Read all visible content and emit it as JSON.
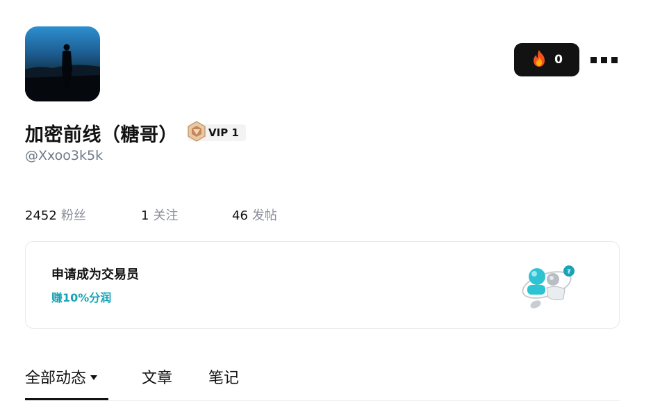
{
  "profile": {
    "name": "加密前线（糖哥）",
    "handle": "@Xxoo3k5k",
    "vip_label": "VIP 1"
  },
  "actions": {
    "fire_count": "0"
  },
  "stats": {
    "followers": {
      "value": "2452",
      "label": "粉丝"
    },
    "following": {
      "value": "1",
      "label": "关注"
    },
    "posts": {
      "value": "46",
      "label": "发帖"
    }
  },
  "trader_card": {
    "title": "申请成为交易员",
    "subtitle": "赚10%分润",
    "accent_color": "#1aa3b6"
  },
  "tabs": [
    {
      "label": "全部动态",
      "active": true
    },
    {
      "label": "文章",
      "active": false
    },
    {
      "label": "笔记",
      "active": false
    }
  ],
  "icons": {
    "fire": "fire-icon",
    "more": "more-icon",
    "vip_badge": "vip-badge-icon"
  }
}
